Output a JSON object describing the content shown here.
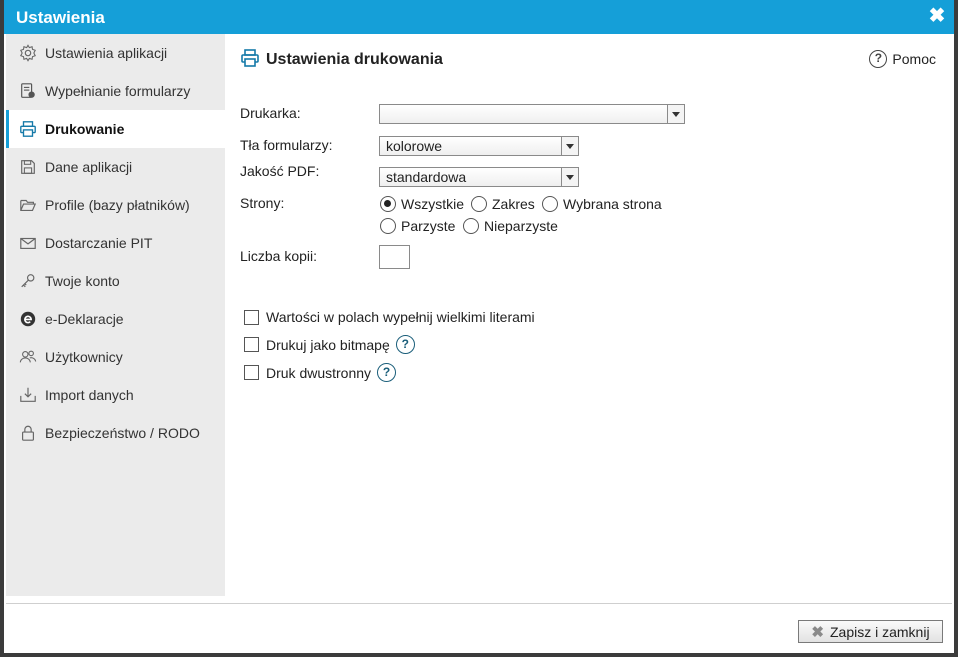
{
  "window": {
    "title": "Ustawienia",
    "close_glyph": "✖"
  },
  "sidebar": {
    "items": [
      {
        "label": "Ustawienia aplikacji",
        "icon": "gear-icon"
      },
      {
        "label": "Wypełnianie formularzy",
        "icon": "form-edit-icon"
      },
      {
        "label": "Drukowanie",
        "icon": "printer-icon",
        "active": true
      },
      {
        "label": "Dane aplikacji",
        "icon": "floppy-disk-icon"
      },
      {
        "label": "Profile (bazy płatników)",
        "icon": "folder-open-icon"
      },
      {
        "label": "Dostarczanie PIT",
        "icon": "envelope-icon"
      },
      {
        "label": "Twoje konto",
        "icon": "key-icon"
      },
      {
        "label": "e-Deklaracje",
        "icon": "e-logo-icon"
      },
      {
        "label": "Użytkownicy",
        "icon": "users-icon"
      },
      {
        "label": "Import danych",
        "icon": "import-tray-icon"
      },
      {
        "label": "Bezpieczeństwo / RODO",
        "icon": "lock-icon"
      }
    ]
  },
  "content": {
    "heading": "Ustawienia drukowania",
    "help_label": "Pomoc",
    "help_glyph": "?",
    "printer": {
      "label": "Drukarka:",
      "value": ""
    },
    "form_bg": {
      "label": "Tła formularzy:",
      "value": "kolorowe"
    },
    "pdf_quality": {
      "label": "Jakość PDF:",
      "value": "standardowa"
    },
    "pages": {
      "label": "Strony:",
      "options": [
        "Wszystkie",
        "Zakres",
        "Wybrana strona",
        "Parzyste",
        "Nieparzyste"
      ],
      "selected": "Wszystkie"
    },
    "copies": {
      "label": "Liczba kopii:",
      "value": ""
    },
    "checkboxes": [
      {
        "label": "Wartości w polach wypełnij wielkimi literami",
        "checked": false,
        "help": false
      },
      {
        "label": "Drukuj jako bitmapę",
        "checked": false,
        "help": true
      },
      {
        "label": "Druk dwustronny",
        "checked": false,
        "help": true
      }
    ],
    "help_icon_glyph": "?"
  },
  "footer": {
    "save_label": "Zapisz i zamknij",
    "save_glyph": "✖"
  },
  "colors": {
    "accent": "#159fd8",
    "help_icon": "#1a5e7a"
  }
}
